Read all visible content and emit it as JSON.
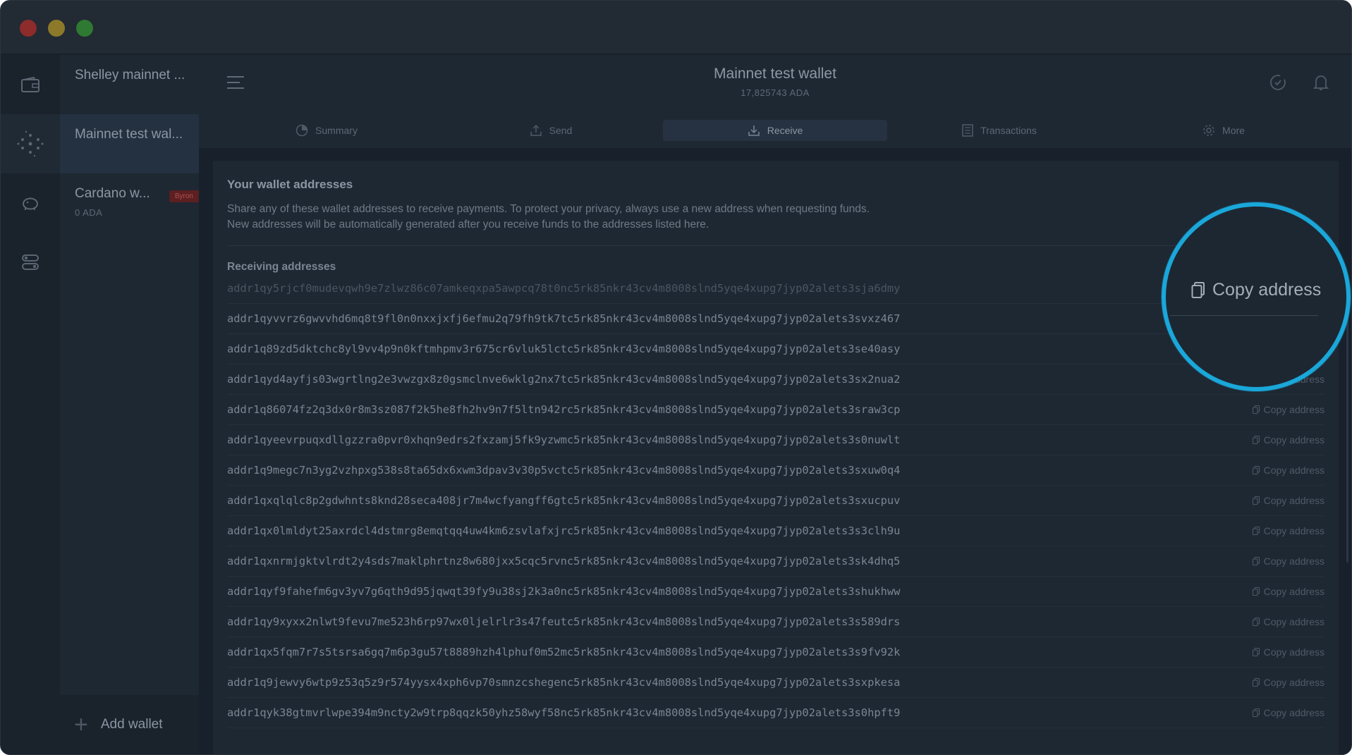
{
  "wallet_header": {
    "title": "Mainnet test wallet",
    "amount": "17,825743 ADA"
  },
  "wallets": [
    {
      "name": "Shelley mainnet ...",
      "balance": ""
    },
    {
      "name": "Mainnet test wal...",
      "balance": ""
    },
    {
      "name": "Cardano w...",
      "balance": "0 ADA",
      "badge": "Byron"
    }
  ],
  "add_wallet_label": "Add wallet",
  "tabs": [
    {
      "label": "Summary",
      "icon": "summary-icon"
    },
    {
      "label": "Send",
      "icon": "send-icon"
    },
    {
      "label": "Receive",
      "icon": "receive-icon",
      "active": true
    },
    {
      "label": "Transactions",
      "icon": "transactions-icon"
    },
    {
      "label": "More",
      "icon": "gear-icon"
    }
  ],
  "receive": {
    "title": "Your wallet addresses",
    "description_line1": "Share any of these wallet addresses to receive payments. To protect your privacy, always use a new address when requesting funds.",
    "description_line2": "New addresses will be automatically generated after you receive funds to the addresses listed here.",
    "receiving_label": "Receiving addresses",
    "copy_label": "Copy address",
    "addresses": [
      "addr1qy5rjcf0mudevqwh9e7zlwz86c07amkeqxpa5awpcq78t0nc5rk85nkr43cv4m8008slnd5yqe4xupg7jyp02alets3sja6dmy",
      "addr1qyvvrz6gwvvhd6mq8t9fl0n0nxxjxfj6efmu2q79fh9tk7tc5rk85nkr43cv4m8008slnd5yqe4xupg7jyp02alets3svxz467",
      "addr1q89zd5dktchc8yl9vv4p9n0kftmhpmv3r675cr6vluk5lctc5rk85nkr43cv4m8008slnd5yqe4xupg7jyp02alets3se40asy",
      "addr1qyd4ayfjs03wgrtlng2e3vwzgx8z0gsmclnve6wklg2nx7tc5rk85nkr43cv4m8008slnd5yqe4xupg7jyp02alets3sx2nua2",
      "addr1q86074fz2q3dx0r8m3sz087f2k5he8fh2hv9n7f5ltn942rc5rk85nkr43cv4m8008slnd5yqe4xupg7jyp02alets3sraw3cp",
      "addr1qyeevrpuqxdllgzzra0pvr0xhqn9edrs2fxzamj5fk9yzwmc5rk85nkr43cv4m8008slnd5yqe4xupg7jyp02alets3s0nuwlt",
      "addr1q9megc7n3yg2vzhpxg538s8ta65dx6xwm3dpav3v30p5vctc5rk85nkr43cv4m8008slnd5yqe4xupg7jyp02alets3sxuw0q4",
      "addr1qxqlqlc8p2gdwhnts8knd28seca408jr7m4wcfyangff6gtc5rk85nkr43cv4m8008slnd5yqe4xupg7jyp02alets3sxucpuv",
      "addr1qx0lmldyt25axrdcl4dstmrg8emqtqq4uw4km6zsvlafxjrc5rk85nkr43cv4m8008slnd5yqe4xupg7jyp02alets3s3clh9u",
      "addr1qxnrmjgktvlrdt2y4sds7maklphrtnz8w680jxx5cqc5rvnc5rk85nkr43cv4m8008slnd5yqe4xupg7jyp02alets3sk4dhq5",
      "addr1qyf9fahefm6gv3yv7g6qth9d95jqwqt39fy9u38sj2k3a0nc5rk85nkr43cv4m8008slnd5yqe4xupg7jyp02alets3shukhww",
      "addr1qy9xyxx2nlwt9fevu7me523h6rp97wx0ljelrlr3s47feutc5rk85nkr43cv4m8008slnd5yqe4xupg7jyp02alets3s589drs",
      "addr1qx5fqm7r7s5tsrsa6gq7m6p3gu57t8889hzh4lphuf0m52mc5rk85nkr43cv4m8008slnd5yqe4xupg7jyp02alets3s9fv92k",
      "addr1q9jewvy6wtp9z53q5z9r574yysx4xph6vp70smnzcshegenc5rk85nkr43cv4m8008slnd5yqe4xupg7jyp02alets3sxpkesa",
      "addr1qyk38gtmvrlwpe394m9ncty2w9trp8qqzk50yhz58wyf58nc5rk85nkr43cv4m8008slnd5yqe4xupg7jyp02alets3s0hpft9"
    ]
  },
  "magnifier": {
    "label": "Copy address"
  }
}
